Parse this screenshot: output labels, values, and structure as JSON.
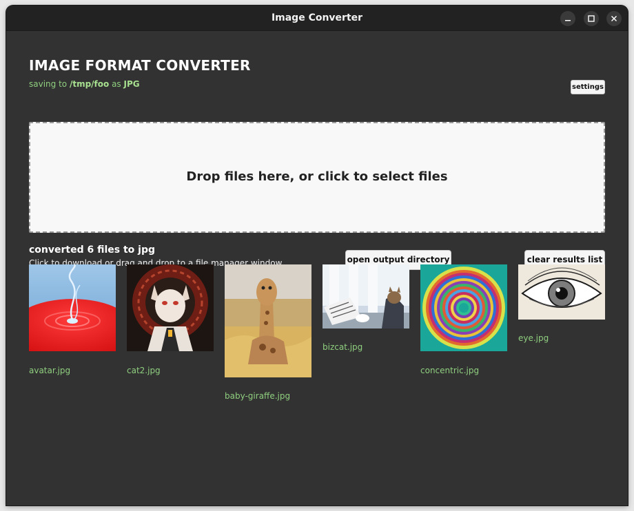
{
  "window": {
    "title": "Image Converter",
    "controls": [
      "minimize",
      "maximize",
      "close"
    ]
  },
  "header": {
    "title": "IMAGE FORMAT CONVERTER",
    "subtitle_prefix": "saving to ",
    "subtitle_path": "/tmp/foo",
    "subtitle_mid": " as ",
    "subtitle_format": "JPG",
    "settings_label": "settings"
  },
  "dropzone": {
    "text": "Drop files here, or click to select files"
  },
  "results": {
    "status": "converted 6 files to jpg",
    "hint": "Click to download or drag and drop to a file manager window",
    "open_output_label": "open output directory",
    "clear_results_label": "clear results list"
  },
  "files": [
    {
      "name": "avatar.jpg"
    },
    {
      "name": "cat2.jpg"
    },
    {
      "name": "baby-giraffe.jpg"
    },
    {
      "name": "bizcat.jpg"
    },
    {
      "name": "concentric.jpg"
    },
    {
      "name": "eye.jpg"
    }
  ],
  "colors": {
    "window_bg": "#323232",
    "titlebar_bg": "#222222",
    "accent_green": "#8fcf7f",
    "dropzone_bg": "#f8f8f8"
  }
}
